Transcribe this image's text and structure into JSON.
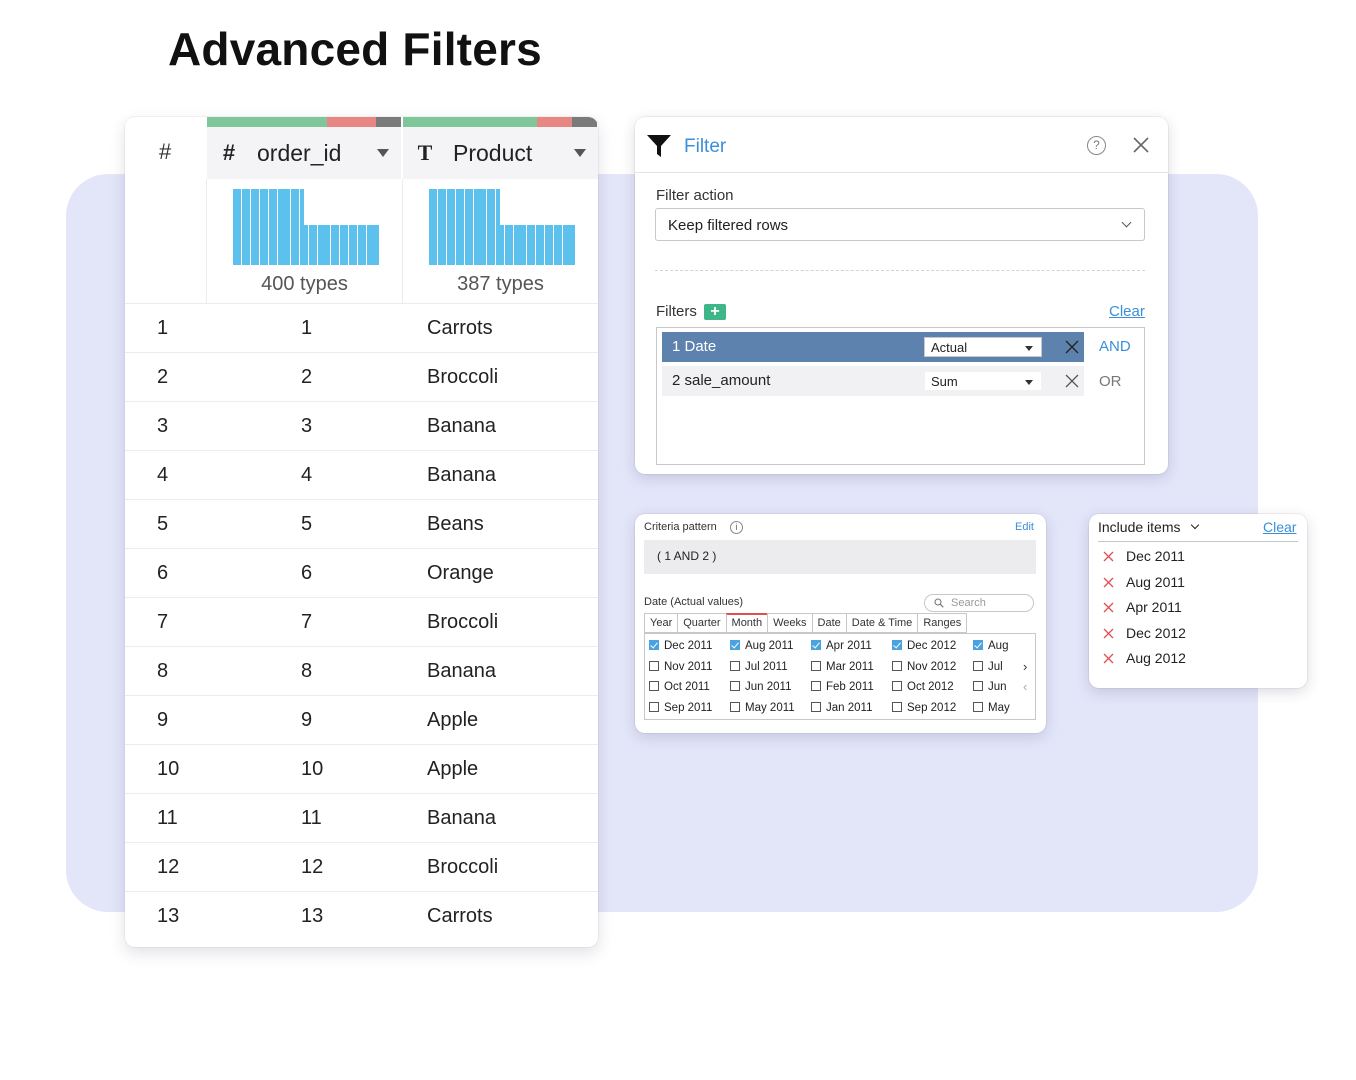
{
  "page": {
    "title": "Advanced Filters"
  },
  "colors": {
    "accent": "#3b8fd9",
    "background_panel": "#e3e5f9",
    "histogram": "#5dc1ee",
    "active_filter": "#5d82ad",
    "add": "#3fb58a",
    "remove": "#e05050"
  },
  "grid": {
    "index_header": "#",
    "columns": [
      {
        "type_icon": "#",
        "name": "order_id",
        "types": "400 types",
        "quality": {
          "valid": 0.62,
          "invalid": 0.25,
          "missing": 0.13
        }
      },
      {
        "type_icon": "T",
        "name": "Product",
        "types": "387 types",
        "quality": {
          "valid": 0.69,
          "invalid": 0.18,
          "missing": 0.13
        }
      }
    ],
    "histograms": [
      [
        1,
        1,
        1,
        1,
        1,
        1,
        1,
        1,
        1,
        1,
        1,
        1,
        1,
        1,
        1,
        1,
        0.53,
        0.53,
        0.53,
        0.53,
        0.53,
        0.53,
        0.53,
        0.53,
        0.53,
        0.53,
        0.53,
        0.53,
        0.53,
        0.53,
        0.53,
        0.53,
        0.53
      ],
      [
        1,
        1,
        1,
        1,
        1,
        1,
        1,
        1,
        1,
        1,
        1,
        1,
        1,
        1,
        1,
        1,
        0.53,
        0.53,
        0.53,
        0.53,
        0.53,
        0.53,
        0.53,
        0.53,
        0.53,
        0.53,
        0.53,
        0.53,
        0.53,
        0.53,
        0.53,
        0.53,
        0.53
      ]
    ],
    "rows": [
      {
        "num": "1",
        "order_id": "1",
        "product": "Carrots"
      },
      {
        "num": "2",
        "order_id": "2",
        "product": "Broccoli"
      },
      {
        "num": "3",
        "order_id": "3",
        "product": "Banana"
      },
      {
        "num": "4",
        "order_id": "4",
        "product": "Banana"
      },
      {
        "num": "5",
        "order_id": "5",
        "product": "Beans"
      },
      {
        "num": "6",
        "order_id": "6",
        "product": "Orange"
      },
      {
        "num": "7",
        "order_id": "7",
        "product": "Broccoli"
      },
      {
        "num": "8",
        "order_id": "8",
        "product": "Banana"
      },
      {
        "num": "9",
        "order_id": "9",
        "product": "Apple"
      },
      {
        "num": "10",
        "order_id": "10",
        "product": "Apple"
      },
      {
        "num": "11",
        "order_id": "11",
        "product": "Banana"
      },
      {
        "num": "12",
        "order_id": "12",
        "product": "Broccoli"
      },
      {
        "num": "13",
        "order_id": "13",
        "product": "Carrots"
      }
    ]
  },
  "filter_dialog": {
    "title": "Filter",
    "help": "?",
    "action_label": "Filter action",
    "action_value": "Keep filtered rows",
    "filters_label": "Filters",
    "add": "+",
    "clear": "Clear",
    "filters": [
      {
        "name": "1  Date",
        "agg": "Actual",
        "logic": "AND",
        "active": true
      },
      {
        "name": "2 sale_amount",
        "agg": "Sum",
        "logic": "OR",
        "active": false
      }
    ]
  },
  "criteria": {
    "label": "Criteria pattern",
    "info": "i",
    "edit": "Edit",
    "pattern": "( 1 AND 2 )",
    "date_label": "Date (Actual values)",
    "search_placeholder": "Search",
    "tabs": [
      "Year",
      "Quarter",
      "Month",
      "Weeks",
      "Date",
      "Date & Time",
      "Ranges"
    ],
    "active_tab": "Month",
    "grid": [
      [
        {
          "label": "Dec 2011",
          "checked": true
        },
        {
          "label": "Aug 2011",
          "checked": true
        },
        {
          "label": "Apr 2011",
          "checked": true
        },
        {
          "label": "Dec 2012",
          "checked": true
        },
        {
          "label": "Aug",
          "checked": true
        }
      ],
      [
        {
          "label": "Nov 2011",
          "checked": false
        },
        {
          "label": "Jul 2011",
          "checked": false
        },
        {
          "label": "Mar 2011",
          "checked": false
        },
        {
          "label": "Nov 2012",
          "checked": false
        },
        {
          "label": "Jul",
          "checked": false
        }
      ],
      [
        {
          "label": "Oct 2011",
          "checked": false
        },
        {
          "label": "Jun 2011",
          "checked": false
        },
        {
          "label": "Feb 2011",
          "checked": false
        },
        {
          "label": "Oct 2012",
          "checked": false
        },
        {
          "label": "Jun",
          "checked": false
        }
      ],
      [
        {
          "label": "Sep 2011",
          "checked": false
        },
        {
          "label": "May 2011",
          "checked": false
        },
        {
          "label": "Jan 2011",
          "checked": false
        },
        {
          "label": "Sep 2012",
          "checked": false
        },
        {
          "label": "May",
          "checked": false
        }
      ]
    ],
    "next": "›",
    "prev": "‹"
  },
  "include_items": {
    "title": "Include items",
    "clear": "Clear",
    "items": [
      "Dec 2011",
      "Aug 2011",
      "Apr 2011",
      "Dec 2012",
      "Aug 2012"
    ]
  }
}
